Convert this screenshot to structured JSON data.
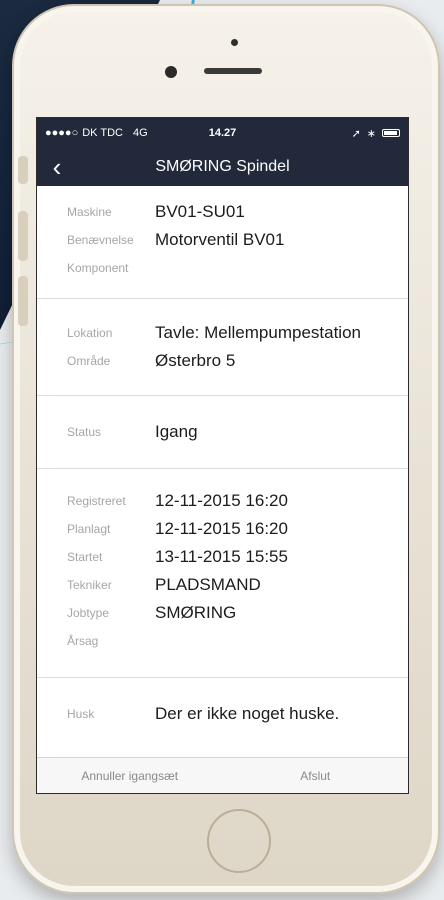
{
  "statusbar": {
    "carrier": "DK TDC",
    "network": "4G",
    "time": "14.27"
  },
  "nav": {
    "back_icon": "chevron-left-icon",
    "title": "SMØRING Spindel"
  },
  "sections": [
    {
      "rows": [
        {
          "label": "Maskine",
          "value": "BV01-SU01"
        },
        {
          "label": "Benævnelse",
          "value": "Motorventil BV01"
        },
        {
          "label": "Komponent",
          "value": ""
        }
      ]
    },
    {
      "rows": [
        {
          "label": "Lokation",
          "value": "Tavle: Mellempumpestation"
        },
        {
          "label": "Område",
          "value": "Østerbro 5"
        }
      ]
    },
    {
      "rows": [
        {
          "label": "Status",
          "value": "Igang"
        }
      ]
    },
    {
      "rows": [
        {
          "label": "Registreret",
          "value": "12-11-2015 16:20"
        },
        {
          "label": "Planlagt",
          "value": "12-11-2015 16:20"
        },
        {
          "label": "Startet",
          "value": "13-11-2015 15:55"
        },
        {
          "label": "Tekniker",
          "value": "PLADSMAND"
        },
        {
          "label": "Jobtype",
          "value": "SMØRING"
        },
        {
          "label": "Årsag",
          "value": ""
        }
      ]
    },
    {
      "rows": [
        {
          "label": "Husk",
          "value": "Der er ikke noget huske."
        }
      ]
    }
  ],
  "toolbar": {
    "cancel_label": "Annuller igangsæt",
    "finish_label": "Afslut"
  },
  "colors": {
    "navbar": "#21293a",
    "label": "#a6a6a6",
    "value": "#1c1c1c",
    "accent_line": "#2aa8e0"
  }
}
